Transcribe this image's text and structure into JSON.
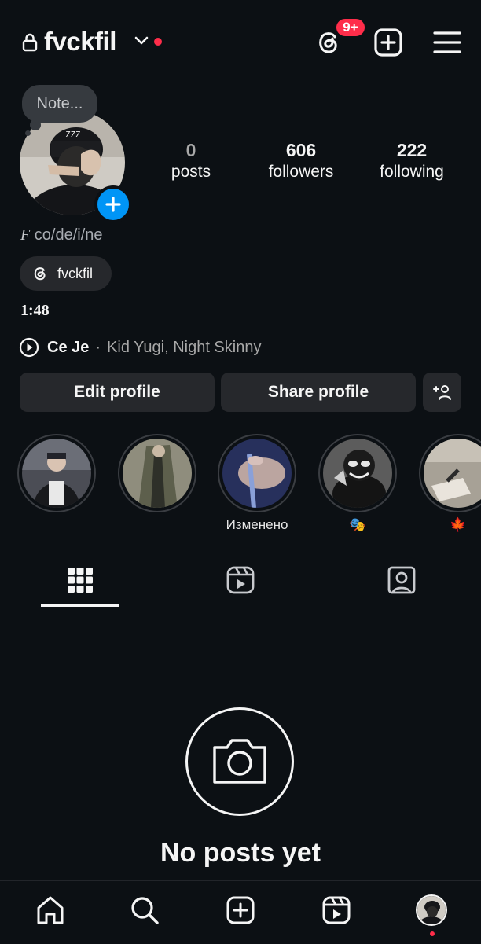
{
  "header": {
    "username": "fvckfil",
    "threads_badge": "9+"
  },
  "note": {
    "placeholder": "Note..."
  },
  "stats": {
    "posts": {
      "count": "0",
      "label": "posts"
    },
    "followers": {
      "count": "606",
      "label": "followers"
    },
    "following": {
      "count": "222",
      "label": "following"
    }
  },
  "bio": {
    "name_prefix": "F",
    "name_rest": " co/de/i/ne",
    "threads_handle": "fvckfil",
    "time_text": "1:48"
  },
  "music": {
    "song": "Ce Je",
    "separator": "·",
    "artists": "Kid Yugi, Night Skinny"
  },
  "actions": {
    "edit_label": "Edit profile",
    "share_label": "Share profile"
  },
  "highlights": [
    {
      "label": ""
    },
    {
      "label": ""
    },
    {
      "label": "Изменено"
    },
    {
      "label": "🎭"
    },
    {
      "label": "🍁"
    }
  ],
  "empty_state": {
    "title": "No posts yet"
  },
  "colors": {
    "background": "#0c1014",
    "accent_blue": "#0095f6",
    "notification_red": "#ff2d4a",
    "button_bg": "#26282c"
  }
}
